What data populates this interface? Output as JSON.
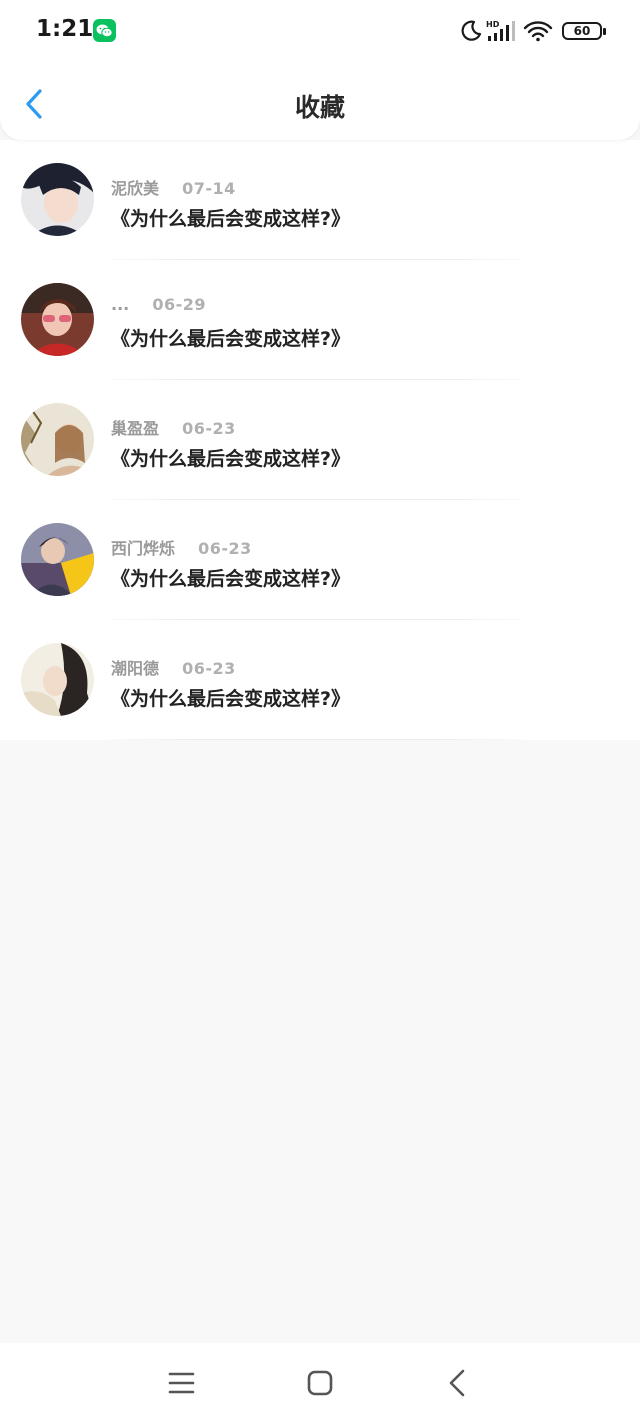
{
  "status_bar": {
    "time": "1:21",
    "network_label": "HD",
    "battery": "60",
    "icons": [
      "wechat-icon",
      "moon-icon",
      "signal-icon",
      "wifi-icon",
      "battery-icon"
    ]
  },
  "header": {
    "title": "收藏",
    "back_icon": "chevron-left-icon",
    "accent_color": "#2d9bf0"
  },
  "favorites": [
    {
      "name": "泥欣美",
      "date": "07-14",
      "title": "《为什么最后会变成这样?》"
    },
    {
      "name": "...",
      "date": "06-29",
      "title": "《为什么最后会变成这样?》"
    },
    {
      "name": "巢盈盈",
      "date": "06-23",
      "title": "《为什么最后会变成这样?》"
    },
    {
      "name": "西门烨烁",
      "date": "06-23",
      "title": "《为什么最后会变成这样?》"
    },
    {
      "name": "潮阳德",
      "date": "06-23",
      "title": "《为什么最后会变成这样?》"
    }
  ],
  "nav_bar": {
    "icons": [
      "menu-icon",
      "home-square-icon",
      "back-triangle-icon"
    ]
  }
}
